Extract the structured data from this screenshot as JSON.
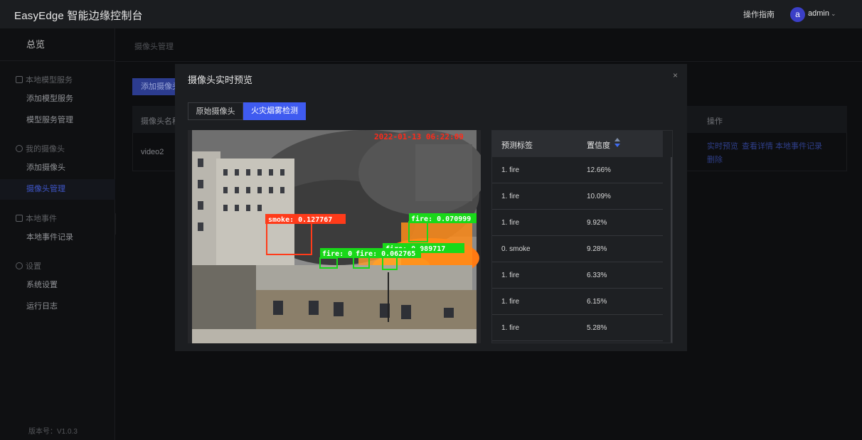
{
  "header": {
    "app_title": "EasyEdge 智能边缘控制台",
    "guide_label": "操作指南",
    "avatar_letter": "a",
    "user_name": "admin"
  },
  "sidebar": {
    "overview": "总览",
    "groups": [
      {
        "label": "本地模型服务",
        "items": [
          "添加模型服务",
          "模型服务管理"
        ]
      },
      {
        "label": "我的摄像头",
        "items": [
          "添加摄像头",
          "摄像头管理"
        ]
      },
      {
        "label": "本地事件",
        "items": [
          "本地事件记录"
        ]
      },
      {
        "label": "设置",
        "items": [
          "系统设置",
          "运行日志"
        ]
      }
    ],
    "active_item": "摄像头管理",
    "version": "版本号：V1.0.3"
  },
  "page": {
    "breadcrumb": "摄像头管理",
    "add_button": "添加摄像头",
    "table_headers": {
      "name": "摄像头名称",
      "actions": "操作"
    },
    "row": {
      "name": "video2",
      "actions": [
        "实时预览",
        "查看详情",
        "本地事件记录",
        "删除"
      ]
    }
  },
  "modal": {
    "title": "摄像头实时预览",
    "close": "×",
    "tabs": [
      "原始摄像头",
      "火灾烟雾检测"
    ],
    "active_tab": "火灾烟雾检测",
    "video": {
      "timestamp": "2022-01-13 06:22:09",
      "detections": [
        {
          "label": "smoke: 0.127767",
          "color": "#ff3b1a"
        },
        {
          "label": "fire: 0.070999",
          "color": "#19d919"
        },
        {
          "label": "fire: 0.089717",
          "color": "#19d919"
        },
        {
          "label": "fire: 0.062765",
          "color": "#19d919"
        },
        {
          "label": "fire: 0",
          "color": "#19d919"
        }
      ]
    },
    "predictions": {
      "headers": {
        "label": "预测标签",
        "confidence": "置信度"
      },
      "rows": [
        {
          "label": "1. fire",
          "confidence": "12.66%"
        },
        {
          "label": "1. fire",
          "confidence": "10.09%"
        },
        {
          "label": "1. fire",
          "confidence": "9.92%"
        },
        {
          "label": "0. smoke",
          "confidence": "9.28%"
        },
        {
          "label": "1. fire",
          "confidence": "6.33%"
        },
        {
          "label": "1. fire",
          "confidence": "6.15%"
        },
        {
          "label": "1. fire",
          "confidence": "5.28%"
        }
      ]
    }
  }
}
